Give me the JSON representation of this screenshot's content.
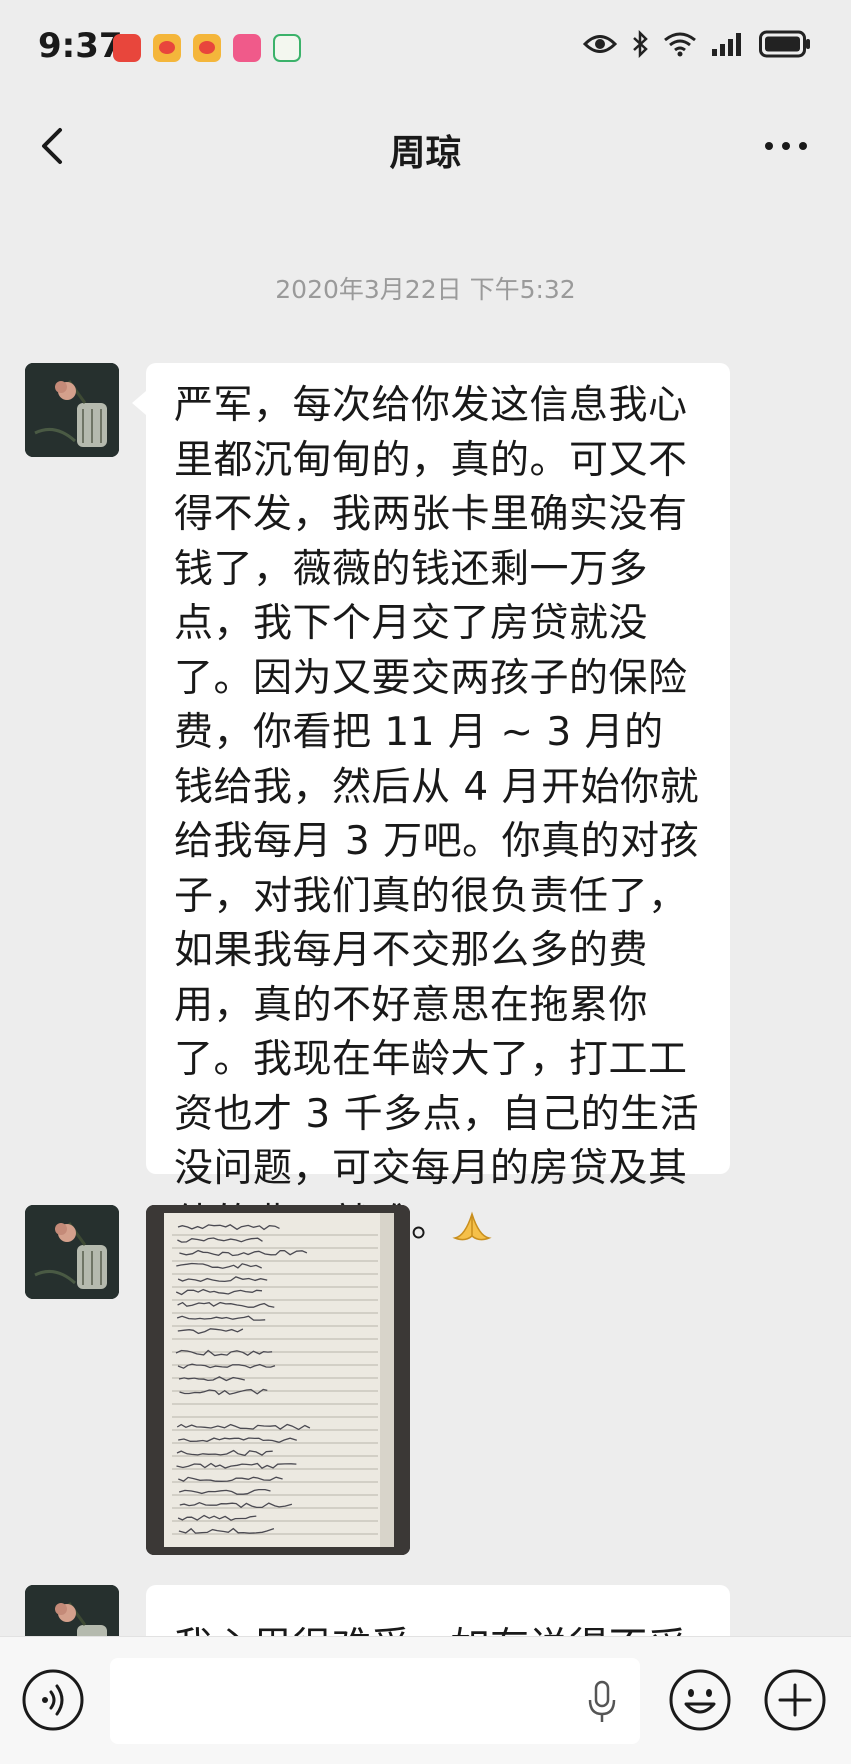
{
  "status_bar": {
    "time": "9:37",
    "notification_icons": [
      "app-notification-icon",
      "weibo-icon",
      "weibo-icon",
      "bilibili-icon",
      "wifi-app-icon"
    ],
    "system_icons": [
      "eye-icon",
      "bluetooth-icon",
      "wifi-icon",
      "signal-icon",
      "battery-icon"
    ]
  },
  "header": {
    "title": "周琼"
  },
  "chat": {
    "timestamp": "2020年3月22日 下午5:32",
    "messages": [
      {
        "type": "text",
        "text": "严军，每次给你发这信息我心里都沉甸甸的，真的。可又不得不发，我两张卡里确实没有钱了，薇薇的钱还剩一万多点，我下个月交了房贷就没了。因为又要交两孩子的保险费，你看把 11 月 ~ 3 月的钱给我，然后从 4 月开始你就给我每月 3 万吧。你真的对孩子，对我们真的很负责任了，如果我每月不交那么多的费用，真的不好意思在拖累你了。我现在年龄大了，打工工资也才 3 千多点，自己的生活没问题，可交每月的房贷及其他的费用就难。",
        "emoji": "folded-hands-emoji"
      },
      {
        "type": "image",
        "description_icon": "notebook-photo"
      },
      {
        "type": "text",
        "text": "我心里很难受，如有说得不妥"
      }
    ]
  },
  "input_bar": {
    "voice_icon": "voice-icon",
    "mic_icon": "microphone-icon",
    "emoji_icon": "smiley-icon",
    "plus_icon": "plus-icon"
  },
  "colors": {
    "background": "#ededed",
    "bubble": "#ffffff",
    "text": "#191919",
    "timestamp": "#9a9a9a"
  }
}
